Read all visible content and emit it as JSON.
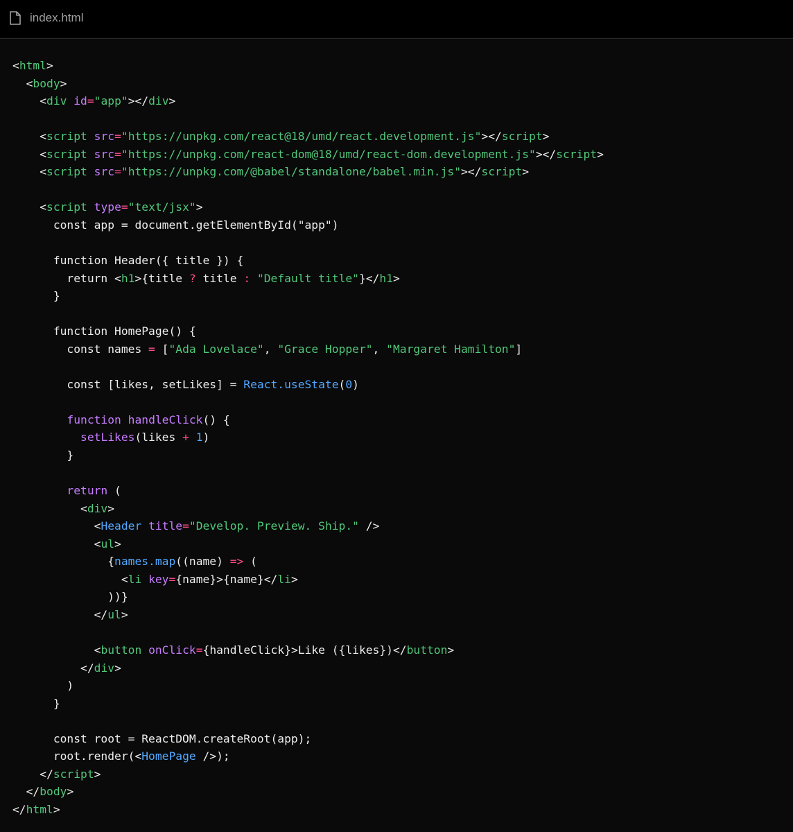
{
  "header": {
    "file_icon": "file-icon",
    "file_name": "index.html"
  },
  "colors": {
    "background": "#0a0a0a",
    "header_background": "#000000",
    "plain": "#ededed",
    "tag": "#52c77a",
    "attribute": "#c77dff",
    "string": "#52c77a",
    "keyword": "#c77dff",
    "function": "#c77dff",
    "component": "#52a8ff",
    "operator": "#ff4d8d",
    "number": "#52a8ff",
    "filename": "#a1a1a1"
  },
  "code": {
    "language": "html",
    "lines": [
      [
        [
          "p",
          "<"
        ],
        [
          "tag",
          "html"
        ],
        [
          "p",
          ">"
        ]
      ],
      [
        [
          "p",
          "  <"
        ],
        [
          "tag",
          "body"
        ],
        [
          "p",
          ">"
        ]
      ],
      [
        [
          "p",
          "    <"
        ],
        [
          "tag",
          "div"
        ],
        [
          "p",
          " "
        ],
        [
          "attr",
          "id"
        ],
        [
          "op",
          "="
        ],
        [
          "str",
          "\"app\""
        ],
        [
          "p",
          "></"
        ],
        [
          "tag",
          "div"
        ],
        [
          "p",
          ">"
        ]
      ],
      [],
      [
        [
          "p",
          "    <"
        ],
        [
          "tag",
          "script"
        ],
        [
          "p",
          " "
        ],
        [
          "attr",
          "src"
        ],
        [
          "op",
          "="
        ],
        [
          "str",
          "\"https://unpkg.com/react@18/umd/react.development.js\""
        ],
        [
          "p",
          "></"
        ],
        [
          "tag",
          "script"
        ],
        [
          "p",
          ">"
        ]
      ],
      [
        [
          "p",
          "    <"
        ],
        [
          "tag",
          "script"
        ],
        [
          "p",
          " "
        ],
        [
          "attr",
          "src"
        ],
        [
          "op",
          "="
        ],
        [
          "str",
          "\"https://unpkg.com/react-dom@18/umd/react-dom.development.js\""
        ],
        [
          "p",
          "></"
        ],
        [
          "tag",
          "script"
        ],
        [
          "p",
          ">"
        ]
      ],
      [
        [
          "p",
          "    <"
        ],
        [
          "tag",
          "script"
        ],
        [
          "p",
          " "
        ],
        [
          "attr",
          "src"
        ],
        [
          "op",
          "="
        ],
        [
          "str",
          "\"https://unpkg.com/@babel/standalone/babel.min.js\""
        ],
        [
          "p",
          "></"
        ],
        [
          "tag",
          "script"
        ],
        [
          "p",
          ">"
        ]
      ],
      [],
      [
        [
          "p",
          "    <"
        ],
        [
          "tag",
          "script"
        ],
        [
          "p",
          " "
        ],
        [
          "attr",
          "type"
        ],
        [
          "op",
          "="
        ],
        [
          "str",
          "\"text/jsx\""
        ],
        [
          "p",
          ">"
        ]
      ],
      [
        [
          "p",
          "      const app = document.getElementById(\"app\")"
        ]
      ],
      [],
      [
        [
          "p",
          "      function Header({ title }) {"
        ]
      ],
      [
        [
          "p",
          "        return <"
        ],
        [
          "tag",
          "h1"
        ],
        [
          "p",
          ">{title "
        ],
        [
          "op",
          "?"
        ],
        [
          "p",
          " title "
        ],
        [
          "op",
          ":"
        ],
        [
          "p",
          " "
        ],
        [
          "str",
          "\"Default title\""
        ],
        [
          "p",
          "}</"
        ],
        [
          "tag",
          "h1"
        ],
        [
          "p",
          ">"
        ]
      ],
      [
        [
          "p",
          "      }"
        ]
      ],
      [],
      [
        [
          "p",
          "      function HomePage() {"
        ]
      ],
      [
        [
          "p",
          "        const names "
        ],
        [
          "op",
          "="
        ],
        [
          "p",
          " ["
        ],
        [
          "str",
          "\"Ada Lovelace\""
        ],
        [
          "p",
          ", "
        ],
        [
          "str",
          "\"Grace Hopper\""
        ],
        [
          "p",
          ", "
        ],
        [
          "str",
          "\"Margaret Hamilton\""
        ],
        [
          "p",
          "]"
        ]
      ],
      [],
      [
        [
          "p",
          "        const [likes, setLikes] = "
        ],
        [
          "comp",
          "React.useState"
        ],
        [
          "p",
          "("
        ],
        [
          "num",
          "0"
        ],
        [
          "p",
          ")"
        ]
      ],
      [],
      [
        [
          "p",
          "        "
        ],
        [
          "kw",
          "function"
        ],
        [
          "p",
          " "
        ],
        [
          "fn",
          "handleClick"
        ],
        [
          "p",
          "() {"
        ]
      ],
      [
        [
          "p",
          "          "
        ],
        [
          "fn",
          "setLikes"
        ],
        [
          "p",
          "(likes "
        ],
        [
          "op",
          "+"
        ],
        [
          "p",
          " "
        ],
        [
          "num",
          "1"
        ],
        [
          "p",
          ")"
        ]
      ],
      [
        [
          "p",
          "        }"
        ]
      ],
      [],
      [
        [
          "p",
          "        "
        ],
        [
          "kw",
          "return"
        ],
        [
          "p",
          " ("
        ]
      ],
      [
        [
          "p",
          "          <"
        ],
        [
          "tag",
          "div"
        ],
        [
          "p",
          ">"
        ]
      ],
      [
        [
          "p",
          "            <"
        ],
        [
          "comp",
          "Header"
        ],
        [
          "p",
          " "
        ],
        [
          "attr",
          "title"
        ],
        [
          "op",
          "="
        ],
        [
          "str",
          "\"Develop. Preview. Ship.\""
        ],
        [
          "p",
          " />"
        ]
      ],
      [
        [
          "p",
          "            <"
        ],
        [
          "tag",
          "ul"
        ],
        [
          "p",
          ">"
        ]
      ],
      [
        [
          "p",
          "              {"
        ],
        [
          "comp",
          "names.map"
        ],
        [
          "p",
          "((name) "
        ],
        [
          "op",
          "=>"
        ],
        [
          "p",
          " ("
        ]
      ],
      [
        [
          "p",
          "                <"
        ],
        [
          "tag",
          "li"
        ],
        [
          "p",
          " "
        ],
        [
          "attr",
          "key"
        ],
        [
          "op",
          "="
        ],
        [
          "p",
          "{name}>{name}</"
        ],
        [
          "tag",
          "li"
        ],
        [
          "p",
          ">"
        ]
      ],
      [
        [
          "p",
          "              ))}"
        ]
      ],
      [
        [
          "p",
          "            </"
        ],
        [
          "tag",
          "ul"
        ],
        [
          "p",
          ">"
        ]
      ],
      [],
      [
        [
          "p",
          "            <"
        ],
        [
          "tag",
          "button"
        ],
        [
          "p",
          " "
        ],
        [
          "attr",
          "onClick"
        ],
        [
          "op",
          "="
        ],
        [
          "p",
          "{handleClick}>Like ({likes})</"
        ],
        [
          "tag",
          "button"
        ],
        [
          "p",
          ">"
        ]
      ],
      [
        [
          "p",
          "          </"
        ],
        [
          "tag",
          "div"
        ],
        [
          "p",
          ">"
        ]
      ],
      [
        [
          "p",
          "        )"
        ]
      ],
      [
        [
          "p",
          "      }"
        ]
      ],
      [],
      [
        [
          "p",
          "      const root = ReactDOM.createRoot(app);"
        ]
      ],
      [
        [
          "p",
          "      root.render(<"
        ],
        [
          "comp",
          "HomePage"
        ],
        [
          "p",
          " />);"
        ]
      ],
      [
        [
          "p",
          "    </"
        ],
        [
          "tag",
          "script"
        ],
        [
          "p",
          ">"
        ]
      ],
      [
        [
          "p",
          "  </"
        ],
        [
          "tag",
          "body"
        ],
        [
          "p",
          ">"
        ]
      ],
      [
        [
          "p",
          "</"
        ],
        [
          "tag",
          "html"
        ],
        [
          "p",
          ">"
        ]
      ]
    ]
  }
}
